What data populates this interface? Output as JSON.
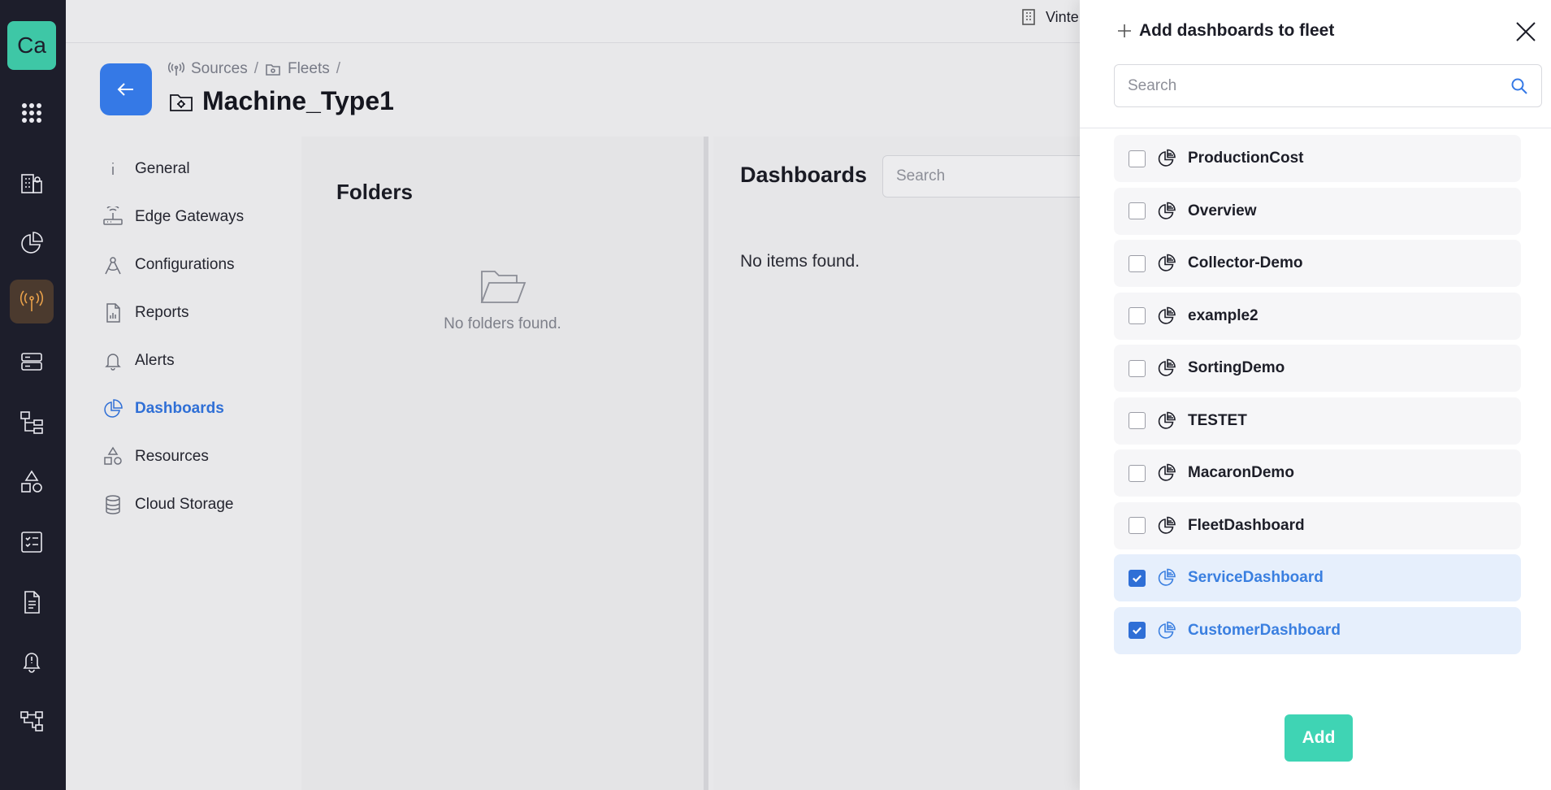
{
  "app": {
    "logo_text": "Ca",
    "org_name": "Vinte"
  },
  "rail": {
    "icons": [
      "apps-grid-icon",
      "buildings-icon",
      "pie-chart-icon",
      "antenna-icon",
      "server-icon",
      "hierarchy-icon",
      "shapes-icon",
      "checklist-icon",
      "document-icon",
      "bell-alert-icon",
      "network-icon"
    ],
    "active": "antenna-icon",
    "active_color": "#e8a04a"
  },
  "breadcrumb": {
    "items": [
      "Sources",
      "Fleets"
    ]
  },
  "page": {
    "title": "Machine_Type1"
  },
  "sidenav": {
    "items": [
      {
        "label": "General",
        "icon": "info-icon"
      },
      {
        "label": "Edge Gateways",
        "icon": "router-icon"
      },
      {
        "label": "Configurations",
        "icon": "compass-icon"
      },
      {
        "label": "Reports",
        "icon": "report-icon"
      },
      {
        "label": "Alerts",
        "icon": "bell-icon"
      },
      {
        "label": "Dashboards",
        "icon": "pie-chart-icon",
        "active": true
      },
      {
        "label": "Resources",
        "icon": "shapes-icon"
      },
      {
        "label": "Cloud Storage",
        "icon": "database-icon"
      }
    ]
  },
  "folders": {
    "title": "Folders",
    "empty_text": "No folders found."
  },
  "dashboards": {
    "title": "Dashboards",
    "search_placeholder": "Search",
    "empty_text": "No items found."
  },
  "drawer": {
    "title": "Add dashboards to fleet",
    "search_placeholder": "Search",
    "items": [
      {
        "label": "ProductionCost",
        "checked": false
      },
      {
        "label": "Overview",
        "checked": false
      },
      {
        "label": "Collector-Demo",
        "checked": false
      },
      {
        "label": "example2",
        "checked": false
      },
      {
        "label": "SortingDemo",
        "checked": false
      },
      {
        "label": "TESTET",
        "checked": false
      },
      {
        "label": "MacaronDemo",
        "checked": false
      },
      {
        "label": "FleetDashboard",
        "checked": false
      },
      {
        "label": "ServiceDashboard",
        "checked": true
      },
      {
        "label": "CustomerDashboard",
        "checked": true
      }
    ],
    "add_label": "Add",
    "accent_color": "#2f6fd6",
    "add_button_color": "#3fd4b4"
  }
}
